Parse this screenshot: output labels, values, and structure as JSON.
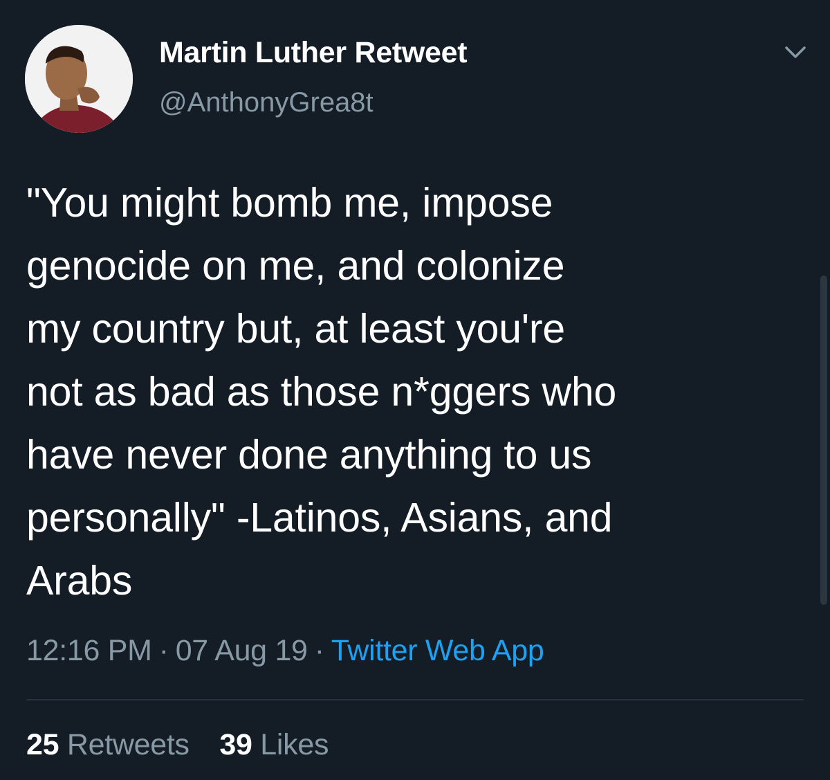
{
  "user": {
    "display_name": "Martin Luther Retweet",
    "handle": "@AnthonyGrea8t",
    "avatar_icon": "profile-photo"
  },
  "tweet": {
    "text": "\"You might bomb me, impose\ngenocide on me, and colonize\nmy country but, at least you're\nnot as bad as those n*ggers who\nhave never done anything to us\npersonally\" -Latinos, Asians, and\nArabs",
    "time": "12:16 PM",
    "date": "07 Aug 19",
    "separator": "·",
    "source": "Twitter Web App"
  },
  "stats": {
    "retweets_count": "25",
    "retweets_label": "Retweets",
    "likes_count": "39",
    "likes_label": "Likes"
  },
  "icons": {
    "menu": "chevron-down-icon"
  },
  "colors": {
    "background": "#141d26",
    "text": "#ffffff",
    "secondary": "#8899a6",
    "link": "#1da1f2"
  }
}
